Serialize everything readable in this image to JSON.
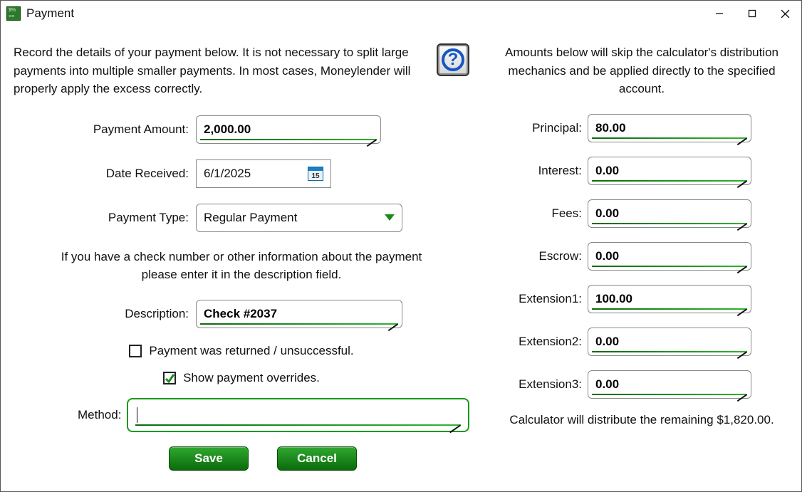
{
  "window": {
    "title": "Payment"
  },
  "left": {
    "instructions": "Record the details of your payment below. It is not necessary to split large payments into multiple smaller payments. In most cases, Moneylender will properly apply the excess correctly.",
    "payment_amount_label": "Payment Amount:",
    "payment_amount": "2,000.00",
    "date_received_label": "Date Received:",
    "date_received": "6/1/2025",
    "calendar_day": "15",
    "payment_type_label": "Payment Type:",
    "payment_type": "Regular Payment",
    "mid_text": "If you have a check number or other information about the payment please enter it in the description field.",
    "description_label": "Description:",
    "description": "Check #2037",
    "returned_label": "Payment was returned / unsuccessful.",
    "returned_checked": false,
    "overrides_label": "Show payment overrides.",
    "overrides_checked": true,
    "method_label": "Method:",
    "method_value": "",
    "save_label": "Save",
    "cancel_label": "Cancel"
  },
  "right": {
    "instructions": "Amounts below will skip the calculator's distribution mechanics and be applied directly to the specified account.",
    "rows": [
      {
        "label": "Principal:",
        "value": "80.00"
      },
      {
        "label": "Interest:",
        "value": "0.00"
      },
      {
        "label": "Fees:",
        "value": "0.00"
      },
      {
        "label": "Escrow:",
        "value": "0.00"
      },
      {
        "label": "Extension1:",
        "value": "100.00"
      },
      {
        "label": "Extension2:",
        "value": "0.00"
      },
      {
        "label": "Extension3:",
        "value": "0.00"
      }
    ],
    "footer": "Calculator will distribute the remaining $1,820.00."
  }
}
